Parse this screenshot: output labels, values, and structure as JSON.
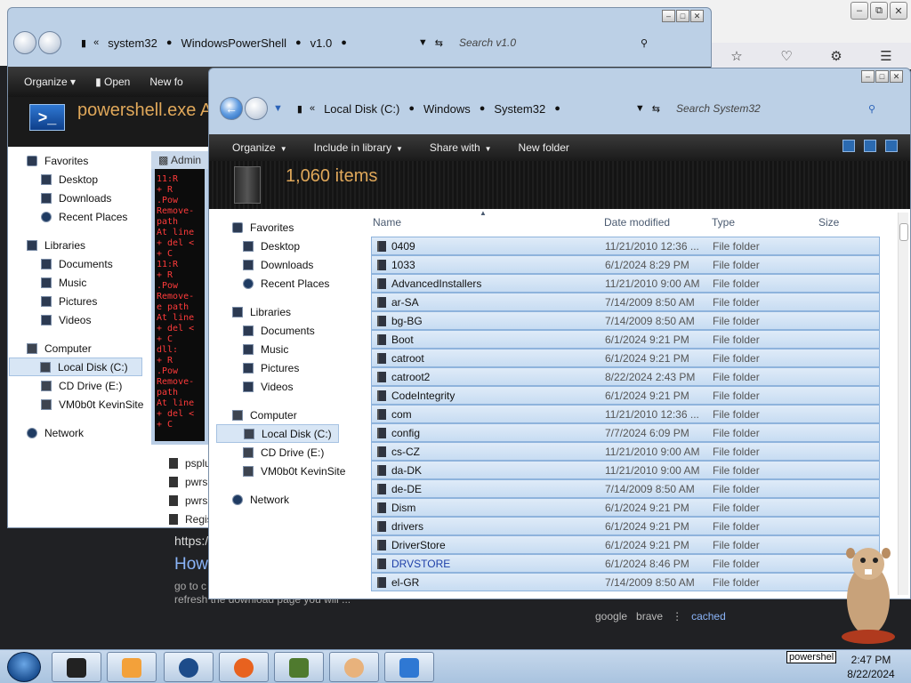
{
  "browser": {
    "snippet_url": "https:/",
    "snippet_title": "How",
    "snippet_text_1": "go to c",
    "snippet_text_2": "refresh the download page you will ...",
    "links": [
      "google",
      "brave",
      "cached"
    ]
  },
  "window1": {
    "breadcrumb": [
      "system32",
      "WindowsPowerShell",
      "v1.0"
    ],
    "search_placeholder": "Search v1.0",
    "toolbar": [
      "Organize",
      "Open",
      "New fo"
    ],
    "title": "powershell.exe A",
    "nav": {
      "favorites": "Favorites",
      "fav_items": [
        "Desktop",
        "Downloads",
        "Recent Places"
      ],
      "libraries": "Libraries",
      "lib_items": [
        "Documents",
        "Music",
        "Pictures",
        "Videos"
      ],
      "computer": "Computer",
      "comp_items": [
        "Local Disk (C:)",
        "CD Drive (E:)",
        "VM0b0t KevinSite"
      ],
      "network": "Network"
    },
    "admin_title": "Admin",
    "console_lines": [
      "11:R",
      "+ R",
      ".Pow",
      "Remove-",
      " path ",
      "At line",
      "+ del <",
      "+ C",
      "11:R",
      "+ R",
      ".Pow",
      "Remove-",
      "e path",
      "At line",
      "+ del <",
      "+ C",
      "dll:",
      "+ R",
      ".Pow",
      "Remove-",
      " path ",
      "At line",
      "+ del <",
      "+ C"
    ],
    "files": [
      "psplu",
      "pwrs",
      "pwrs",
      "Regis"
    ]
  },
  "window2": {
    "breadcrumb": [
      "Local Disk (C:)",
      "Windows",
      "System32"
    ],
    "search_placeholder": "Search System32",
    "toolbar": [
      "Organize",
      "Include in library",
      "Share with",
      "New folder"
    ],
    "item_count": "1,060 items",
    "nav": {
      "favorites": "Favorites",
      "fav_items": [
        "Desktop",
        "Downloads",
        "Recent Places"
      ],
      "libraries": "Libraries",
      "lib_items": [
        "Documents",
        "Music",
        "Pictures",
        "Videos"
      ],
      "computer": "Computer",
      "comp_items": [
        "Local Disk (C:)",
        "CD Drive (E:)",
        "VM0b0t KevinSite"
      ],
      "network": "Network"
    },
    "columns": [
      "Name",
      "Date modified",
      "Type",
      "Size"
    ],
    "rows": [
      {
        "name": "0409",
        "date": "11/21/2010 12:36 ...",
        "type": "File folder"
      },
      {
        "name": "1033",
        "date": "6/1/2024 8:29 PM",
        "type": "File folder"
      },
      {
        "name": "AdvancedInstallers",
        "date": "11/21/2010 9:00 AM",
        "type": "File folder"
      },
      {
        "name": "ar-SA",
        "date": "7/14/2009 8:50 AM",
        "type": "File folder"
      },
      {
        "name": "bg-BG",
        "date": "7/14/2009 8:50 AM",
        "type": "File folder"
      },
      {
        "name": "Boot",
        "date": "6/1/2024 9:21 PM",
        "type": "File folder"
      },
      {
        "name": "catroot",
        "date": "6/1/2024 9:21 PM",
        "type": "File folder"
      },
      {
        "name": "catroot2",
        "date": "8/22/2024 2:43 PM",
        "type": "File folder"
      },
      {
        "name": "CodeIntegrity",
        "date": "6/1/2024 9:21 PM",
        "type": "File folder"
      },
      {
        "name": "com",
        "date": "11/21/2010 12:36 ...",
        "type": "File folder"
      },
      {
        "name": "config",
        "date": "7/7/2024 6:09 PM",
        "type": "File folder"
      },
      {
        "name": "cs-CZ",
        "date": "11/21/2010 9:00 AM",
        "type": "File folder"
      },
      {
        "name": "da-DK",
        "date": "11/21/2010 9:00 AM",
        "type": "File folder"
      },
      {
        "name": "de-DE",
        "date": "7/14/2009 8:50 AM",
        "type": "File folder"
      },
      {
        "name": "Dism",
        "date": "6/1/2024 9:21 PM",
        "type": "File folder"
      },
      {
        "name": "drivers",
        "date": "6/1/2024 9:21 PM",
        "type": "File folder"
      },
      {
        "name": "DriverStore",
        "date": "6/1/2024 9:21 PM",
        "type": "File folder"
      },
      {
        "name": "DRVSTORE",
        "date": "6/1/2024 8:46 PM",
        "type": "File folder"
      },
      {
        "name": "el-GR",
        "date": "7/14/2009 8:50 AM",
        "type": "File folder"
      }
    ]
  },
  "taskbar": {
    "tooltip": "powershel",
    "time": "2:47 PM",
    "date": "8/22/2024"
  }
}
